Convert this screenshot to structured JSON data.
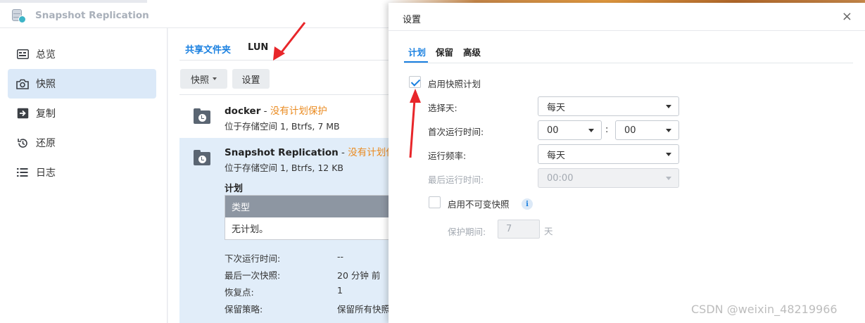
{
  "app": {
    "title": "Snapshot Replication"
  },
  "sidebar": {
    "items": [
      {
        "label": "总览",
        "icon": "overview-icon"
      },
      {
        "label": "快照",
        "icon": "camera-icon",
        "active": true
      },
      {
        "label": "复制",
        "icon": "replication-icon"
      },
      {
        "label": "还原",
        "icon": "restore-icon"
      },
      {
        "label": "日志",
        "icon": "log-list-icon"
      }
    ]
  },
  "main": {
    "tabs": [
      {
        "label": "共享文件夹",
        "active": true
      },
      {
        "label": "LUN"
      }
    ],
    "buttons": {
      "snapshot": "快照",
      "settings": "设置"
    },
    "folders": [
      {
        "name": "docker",
        "status": "没有计划保护",
        "sep": " - ",
        "location": "位于存储空间 1, Btrfs, 7 MB"
      },
      {
        "name": "Snapshot Replication",
        "status": "没有计划保",
        "sep": " - ",
        "location": "位于存储空间 1, Btrfs, 12 KB"
      }
    ],
    "detail": {
      "plan_label": "计划",
      "table_header": "类型",
      "table_value": "无计划。",
      "rows": [
        {
          "label": "下次运行时间:",
          "value": "--"
        },
        {
          "label": "最后一次快照:",
          "value": "20 分钟 前"
        },
        {
          "label": "恢复点:",
          "value": "1"
        },
        {
          "label": "保留策略:",
          "value": "保留所有快照"
        }
      ]
    }
  },
  "dialog": {
    "title": "设置",
    "close": "×",
    "tabs": [
      {
        "label": "计划",
        "active": true
      },
      {
        "label": "保留"
      },
      {
        "label": "高级"
      }
    ],
    "enable_schedule": {
      "label": "启用快照计划",
      "checked": true
    },
    "fields": {
      "choose_day": {
        "label": "选择天:",
        "value": "每天"
      },
      "first_run": {
        "label": "首次运行时间:",
        "hour": "00",
        "minute": "00",
        "separator": ":"
      },
      "frequency": {
        "label": "运行频率:",
        "value": "每天"
      },
      "last_run": {
        "label": "最后运行时间:",
        "value": "00:00",
        "disabled": true
      }
    },
    "immutable": {
      "label": "启用不可变快照",
      "checked": false,
      "info_icon": "i"
    },
    "protection": {
      "label": "保护期间:",
      "value": "7",
      "unit": "天",
      "disabled": true
    }
  },
  "watermark": "CSDN @weixin_48219966",
  "colors": {
    "accent": "#1a80e0",
    "warning": "#ea8a1f",
    "arrow": "#e8262a",
    "selected_row": "#e1edf9"
  }
}
